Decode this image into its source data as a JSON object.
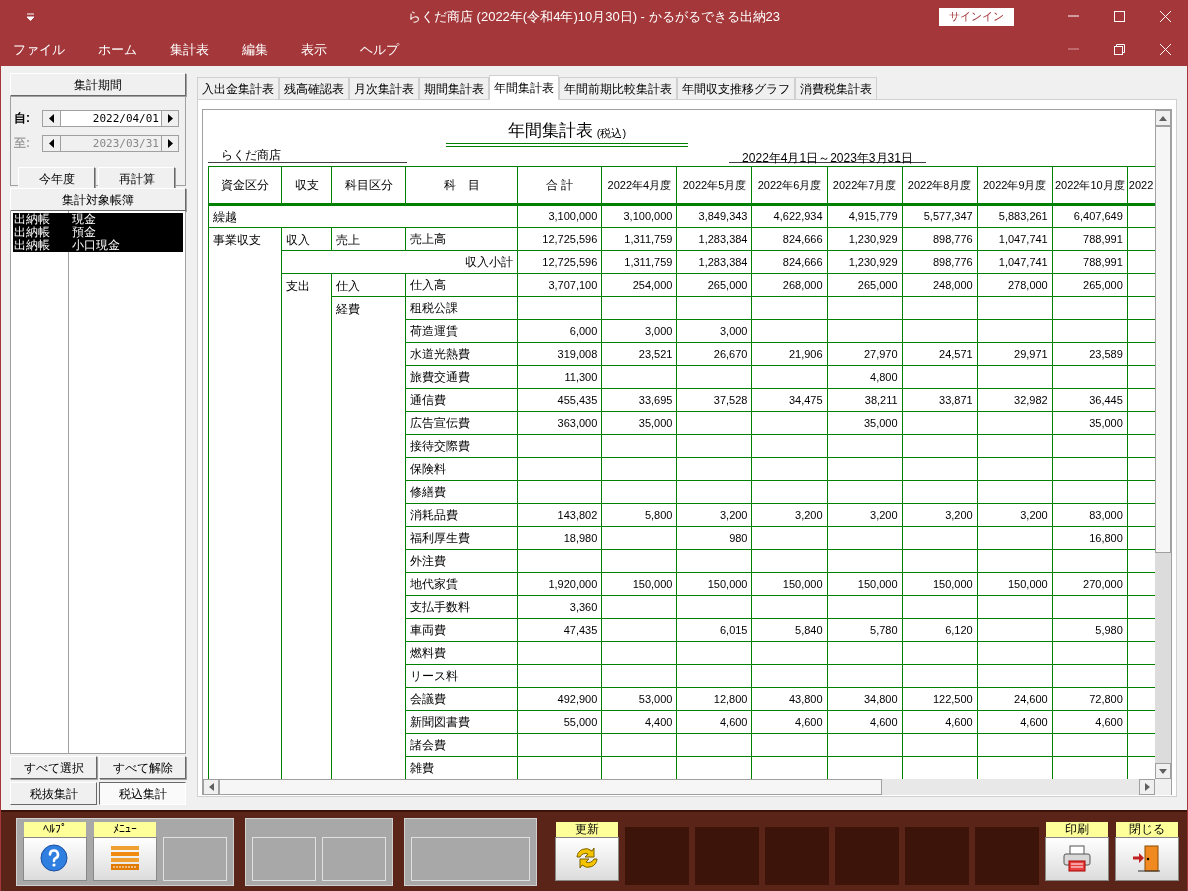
{
  "window": {
    "title": "らくだ商店 (2022年(令和4年)10月30日)  -  かるがるできる出納23",
    "signin": "サインイン"
  },
  "menu": [
    "ファイル",
    "ホーム",
    "集計表",
    "編集",
    "表示",
    "ヘルプ"
  ],
  "left": {
    "period_header": "集計期間",
    "from": {
      "label": "自:",
      "value": "2022/04/01",
      "disabled": false
    },
    "to": {
      "label": "至:",
      "value": "2023/03/31",
      "disabled": true
    },
    "buttons": [
      "今年度",
      "再計算"
    ],
    "books_header": "集計対象帳簿",
    "books": [
      {
        "type": "出納帳",
        "name": "現金",
        "selected": true
      },
      {
        "type": "出納帳",
        "name": "預金",
        "selected": true
      },
      {
        "type": "出納帳",
        "name": "小口現金",
        "selected": true
      }
    ],
    "select_buttons": [
      "すべて選択",
      "すべて解除"
    ],
    "tax_modes": [
      {
        "label": "税抜集計",
        "selected": false
      },
      {
        "label": "税込集計",
        "selected": true
      }
    ]
  },
  "tabs": [
    {
      "label": "入出金集計表",
      "selected": false
    },
    {
      "label": "残高確認表",
      "selected": false
    },
    {
      "label": "月次集計表",
      "selected": false
    },
    {
      "label": "期間集計表",
      "selected": false
    },
    {
      "label": "年間集計表",
      "selected": true
    },
    {
      "label": "年間前期比較集計表",
      "selected": false
    },
    {
      "label": "年間収支推移グラフ",
      "selected": false
    },
    {
      "label": "消費税集計表",
      "selected": false
    }
  ],
  "report": {
    "title": "年間集計表",
    "title_note": "(税込)",
    "shop": "らくだ商店",
    "period": "2022年4月1日～2023年3月31日",
    "columns": [
      "資金区分",
      "収支",
      "科目区分",
      "科　目",
      "合 計",
      "2022年4月度",
      "2022年5月度",
      "2022年6月度",
      "2022年7月度",
      "2022年8月度",
      "2022年9月度",
      "2022年10月度",
      "2022"
    ],
    "rows": [
      {
        "kind": "carry",
        "label": "繰越",
        "values": {
          "total": "3,100,000",
          "m1": "3,100,000",
          "m2": "3,849,343",
          "m3": "4,622,934",
          "m4": "4,915,779",
          "m5": "5,577,347",
          "m6": "5,883,261",
          "m7": "6,407,649"
        }
      },
      {
        "kind": "item",
        "fund": "事業収支",
        "flow": "収入",
        "category": "売上",
        "item": "売上高",
        "values": {
          "total": "12,725,596",
          "m1": "1,311,759",
          "m2": "1,283,384",
          "m3": "824,666",
          "m4": "1,230,929",
          "m5": "898,776",
          "m6": "1,047,741",
          "m7": "788,991"
        }
      },
      {
        "kind": "subtotal",
        "label": "収入小計",
        "values": {
          "total": "12,725,596",
          "m1": "1,311,759",
          "m2": "1,283,384",
          "m3": "824,666",
          "m4": "1,230,929",
          "m5": "898,776",
          "m6": "1,047,741",
          "m7": "788,991"
        }
      },
      {
        "kind": "item",
        "flow": "支出",
        "category": "仕入",
        "item": "仕入高",
        "values": {
          "total": "3,707,100",
          "m1": "254,000",
          "m2": "265,000",
          "m3": "268,000",
          "m4": "265,000",
          "m5": "248,000",
          "m6": "278,000",
          "m7": "265,000"
        }
      },
      {
        "kind": "item",
        "category": "経費",
        "item": "租税公課"
      },
      {
        "kind": "item",
        "item": "荷造運賃",
        "values": {
          "total": "6,000",
          "m1": "3,000",
          "m2": "3,000"
        }
      },
      {
        "kind": "item",
        "item": "水道光熱費",
        "values": {
          "total": "319,008",
          "m1": "23,521",
          "m2": "26,670",
          "m3": "21,906",
          "m4": "27,970",
          "m5": "24,571",
          "m6": "29,971",
          "m7": "23,589"
        }
      },
      {
        "kind": "item",
        "item": "旅費交通費",
        "values": {
          "total": "11,300",
          "m4": "4,800"
        }
      },
      {
        "kind": "item",
        "item": "通信費",
        "values": {
          "total": "455,435",
          "m1": "33,695",
          "m2": "37,528",
          "m3": "34,475",
          "m4": "38,211",
          "m5": "33,871",
          "m6": "32,982",
          "m7": "36,445"
        }
      },
      {
        "kind": "item",
        "item": "広告宣伝費",
        "values": {
          "total": "363,000",
          "m1": "35,000",
          "m4": "35,000",
          "m7": "35,000"
        }
      },
      {
        "kind": "item",
        "item": "接待交際費"
      },
      {
        "kind": "item",
        "item": "保険料"
      },
      {
        "kind": "item",
        "item": "修繕費"
      },
      {
        "kind": "item",
        "item": "消耗品費",
        "values": {
          "total": "143,802",
          "m1": "5,800",
          "m2": "3,200",
          "m3": "3,200",
          "m4": "3,200",
          "m5": "3,200",
          "m6": "3,200",
          "m7": "83,000"
        }
      },
      {
        "kind": "item",
        "item": "福利厚生費",
        "values": {
          "total": "18,980",
          "m2": "980",
          "m7": "16,800"
        }
      },
      {
        "kind": "item",
        "item": "外注費"
      },
      {
        "kind": "item",
        "item": "地代家賃",
        "values": {
          "total": "1,920,000",
          "m1": "150,000",
          "m2": "150,000",
          "m3": "150,000",
          "m4": "150,000",
          "m5": "150,000",
          "m6": "150,000",
          "m7": "270,000"
        }
      },
      {
        "kind": "item",
        "item": "支払手数料",
        "values": {
          "total": "3,360"
        }
      },
      {
        "kind": "item",
        "item": "車両費",
        "values": {
          "total": "47,435",
          "m2": "6,015",
          "m3": "5,840",
          "m4": "5,780",
          "m5": "6,120",
          "m7": "5,980"
        }
      },
      {
        "kind": "item",
        "item": "燃料費"
      },
      {
        "kind": "item",
        "item": "リース料"
      },
      {
        "kind": "item",
        "item": "会議費",
        "values": {
          "total": "492,900",
          "m1": "53,000",
          "m2": "12,800",
          "m3": "43,800",
          "m4": "34,800",
          "m5": "122,500",
          "m6": "24,600",
          "m7": "72,800"
        }
      },
      {
        "kind": "item",
        "item": "新聞図書費",
        "values": {
          "total": "55,000",
          "m1": "4,400",
          "m2": "4,600",
          "m3": "4,600",
          "m4": "4,600",
          "m5": "4,600",
          "m6": "4,600",
          "m7": "4,600"
        }
      },
      {
        "kind": "item",
        "item": "諸会費"
      },
      {
        "kind": "item",
        "item": "雑費"
      }
    ]
  },
  "toolbar": [
    {
      "kind": "panel",
      "slots": [
        {
          "kind": "help",
          "label": "ﾍﾙﾌﾟ"
        },
        {
          "kind": "menu",
          "label": "ﾒﾆｭｰ"
        },
        {
          "kind": "empty"
        }
      ]
    },
    {
      "kind": "panel",
      "slots": [
        {
          "kind": "empty"
        },
        {
          "kind": "empty"
        }
      ]
    },
    {
      "kind": "panel",
      "slots": [
        {
          "kind": "wide"
        }
      ]
    },
    {
      "kind": "refresh",
      "label": "更新"
    },
    {
      "kind": "dark"
    },
    {
      "kind": "dark"
    },
    {
      "kind": "dark"
    },
    {
      "kind": "dark"
    },
    {
      "kind": "dark"
    },
    {
      "kind": "dark"
    },
    {
      "kind": "print",
      "label": "印刷"
    },
    {
      "kind": "exit",
      "label": "閉じる"
    }
  ]
}
